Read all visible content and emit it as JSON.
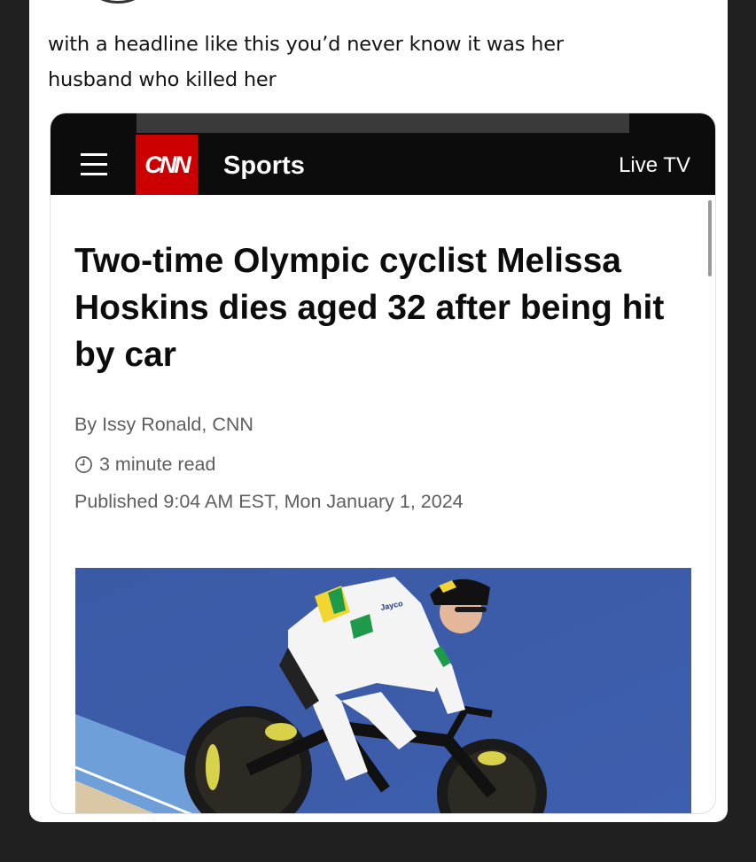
{
  "post": {
    "text_line1": "with a headline like this you’d never know it was her",
    "text_line2": "husband who killed her"
  },
  "article": {
    "header": {
      "menu_icon": "hamburger-menu-icon",
      "logo_text": "CNN",
      "section": "Sports",
      "live_tv": "Live TV"
    },
    "headline": "Two-time Olympic cyclist Melissa Hoskins dies aged 32 after being hit by car",
    "byline": "By Issy Ronald, CNN",
    "read_time": "3 minute read",
    "read_time_icon": "clock-icon",
    "published": "Published 9:04 AM EST, Mon January 1, 2024",
    "image": {
      "jersey_text": "Jayco"
    }
  },
  "colors": {
    "page_background": "#202020",
    "cnn_red": "#cc0000",
    "header_black": "#0c0c0c",
    "meta_gray": "#5e5e5e"
  }
}
